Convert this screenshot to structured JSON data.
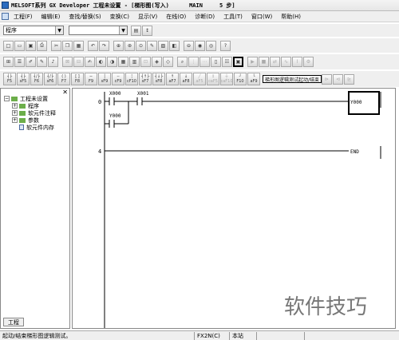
{
  "window": {
    "title": "MELSOFT系列 GX Developer 工程未设置 - [梯形图(写入)      MAIN     5 步]"
  },
  "menu": {
    "items": [
      "工程(F)",
      "编辑(E)",
      "查找/替换(S)",
      "变换(C)",
      "显示(V)",
      "在线(O)",
      "诊断(D)",
      "工具(T)",
      "窗口(W)",
      "帮助(H)"
    ]
  },
  "toolbar": {
    "program_select": "程序",
    "device_select": "",
    "row1": [
      "new-icon",
      "open-icon",
      "save-icon",
      "print-icon",
      "cut-icon",
      "copy-icon",
      "paste-icon",
      "undo-icon",
      "redo-icon",
      "find-icon",
      "find-device-icon",
      "find-instruction-icon",
      "zoom-icon",
      "write-icon",
      "read-icon",
      "verify-icon",
      "monitor-icon",
      "monitor-write-icon",
      "help-icon"
    ],
    "row2_count": 24,
    "row3": [
      "F5",
      "sF5",
      "F6",
      "sF6",
      "F7",
      "F8",
      "F9",
      "sF9",
      "cF9",
      "cF10",
      "sF7",
      "sF8",
      "aF7",
      "aF8",
      "aF5",
      "caF5",
      "caF10",
      "F10",
      "aF9"
    ],
    "row3_tooltip": "梯形图逻辑测试起动/结束"
  },
  "project_pane": {
    "tree": [
      {
        "label": "工程未设置",
        "level": 0,
        "icon": "folder-icon"
      },
      {
        "label": "程序",
        "level": 1,
        "icon": "folder-icon"
      },
      {
        "label": "软元件注释",
        "level": 1,
        "icon": "folder-icon"
      },
      {
        "label": "参数",
        "level": 1,
        "icon": "folder-icon"
      },
      {
        "label": "软元件内存",
        "level": 1,
        "icon": "doc-icon"
      }
    ],
    "tab": "工程"
  },
  "ladder": {
    "rungs": [
      {
        "step": "0",
        "contacts": [
          "X000",
          "X001"
        ],
        "parallel": "Y000",
        "coil": "Y000"
      },
      {
        "step": "4",
        "end": "END"
      }
    ]
  },
  "status": {
    "message": "起动/结束梯形图逻辑测试。",
    "cpu": "FX2N(C)",
    "mode": "本站"
  },
  "watermark": "软件技巧",
  "colors": {
    "selection": "#000000",
    "folder": "#6cae4a"
  }
}
